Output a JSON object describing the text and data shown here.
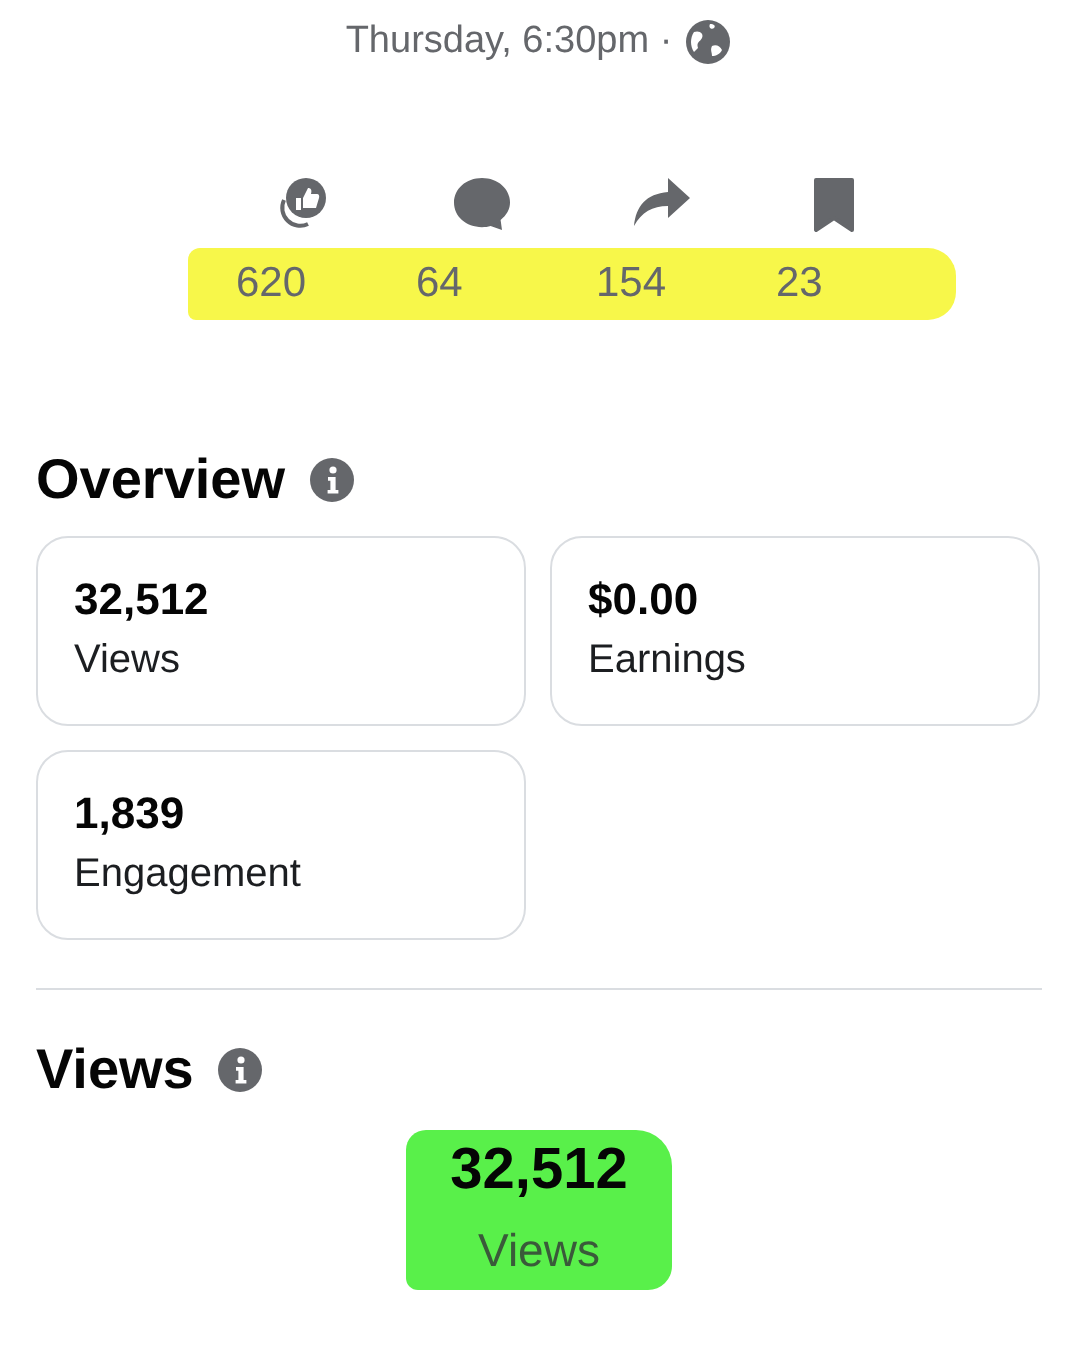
{
  "timestamp": "Thursday, 6:30pm ·",
  "stats": [
    {
      "kind": "reactions",
      "count": "620"
    },
    {
      "kind": "comments",
      "count": "64"
    },
    {
      "kind": "shares",
      "count": "154"
    },
    {
      "kind": "saves",
      "count": "23"
    }
  ],
  "overview": {
    "title": "Overview",
    "cards": [
      {
        "value": "32,512",
        "label": "Views"
      },
      {
        "value": "$0.00",
        "label": "Earnings"
      },
      {
        "value": "1,839",
        "label": "Engagement"
      }
    ]
  },
  "views": {
    "title": "Views",
    "value": "32,512",
    "label": "Views"
  }
}
